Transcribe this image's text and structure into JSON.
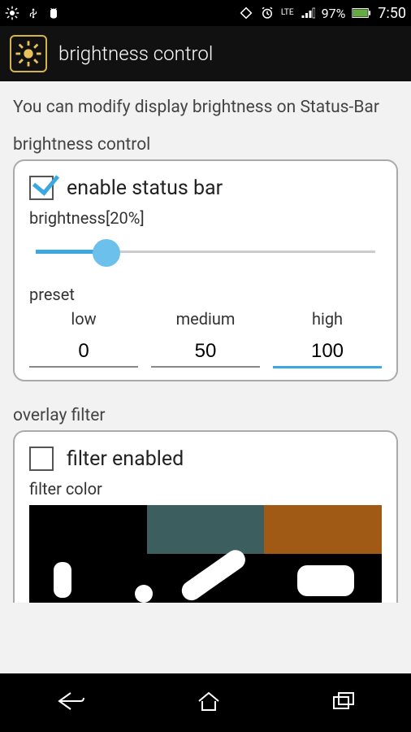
{
  "status": {
    "battery_pct": "97%",
    "time": "7:50",
    "network_label": "LTE"
  },
  "app": {
    "title": "brightness control"
  },
  "description": "You can modify display brightness on Status-Bar",
  "brightness": {
    "section_label": "brightness control",
    "enable_label": "enable status bar",
    "enable_checked": true,
    "slider_label": "brightness[20%]",
    "slider_value": 20,
    "preset_label": "preset",
    "presets": [
      {
        "label": "low",
        "value": "0"
      },
      {
        "label": "medium",
        "value": "50"
      },
      {
        "label": "high",
        "value": "100"
      }
    ],
    "focused_preset_index": 2
  },
  "overlay": {
    "section_label": "overlay filter",
    "enable_label": "filter enabled",
    "enable_checked": false,
    "color_label": "filter color",
    "swatches": [
      "#000000",
      "#3d5e5e",
      "#a05a16"
    ]
  }
}
